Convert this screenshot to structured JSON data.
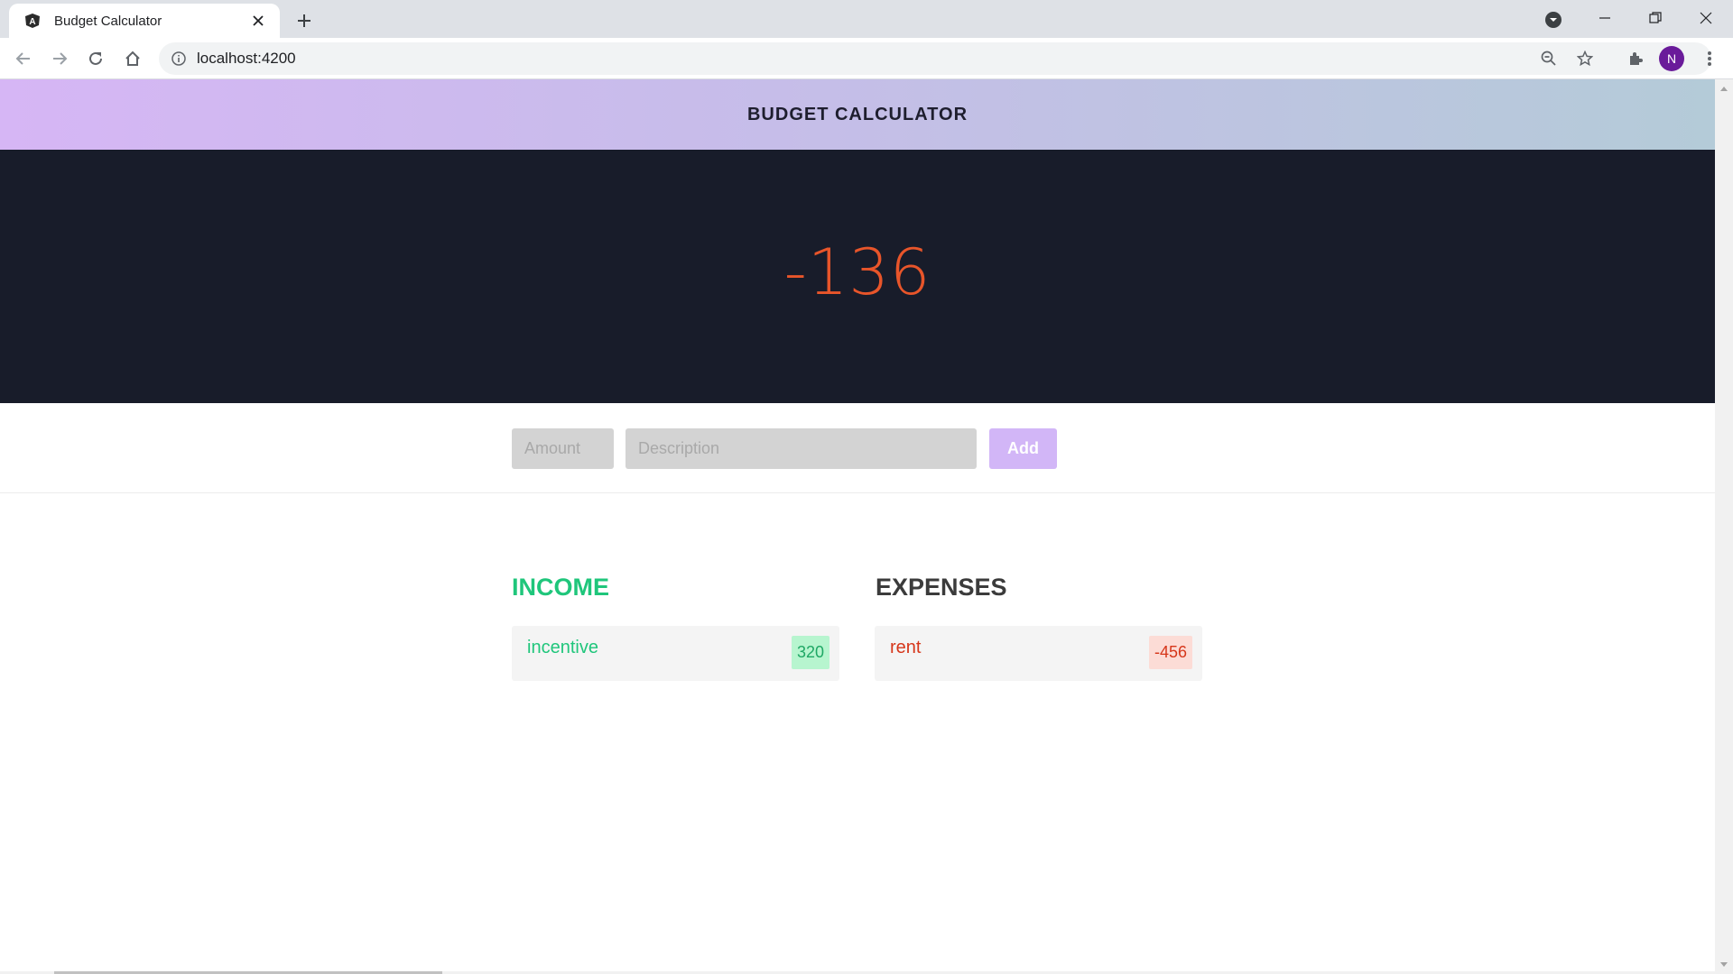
{
  "browser": {
    "tab_title": "Budget Calculator",
    "url": "localhost:4200",
    "profile_initial": "N"
  },
  "app": {
    "title": "BUDGET CALCULATOR",
    "total": "-136",
    "form": {
      "amount_placeholder": "Amount",
      "description_placeholder": "Description",
      "add_label": "Add"
    },
    "income": {
      "title": "INCOME",
      "items": [
        {
          "description": "incentive",
          "amount": "320"
        }
      ]
    },
    "expenses": {
      "title": "EXPENSES",
      "items": [
        {
          "description": "rent",
          "amount": "-456"
        }
      ]
    }
  },
  "colors": {
    "income": "#1fc67b",
    "expense": "#d6361a",
    "total": "#e8552a",
    "band": "#181c2a",
    "add_button": "#d2b6f7"
  }
}
